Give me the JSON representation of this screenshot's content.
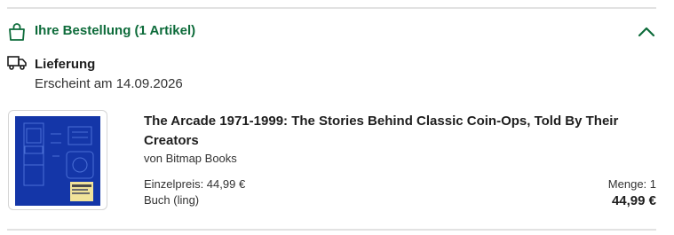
{
  "order": {
    "title": "Ihre Bestellung (1 Artikel)",
    "accent_color": "#0d6b3a",
    "icons": {
      "bag": "shopping-bag-icon",
      "toggle": "chevron-up-icon"
    }
  },
  "delivery": {
    "label": "Lieferung",
    "date_text": "Erscheint am 14.09.2026",
    "icon": "truck-icon"
  },
  "item": {
    "title": "The Arcade 1971-1999: The Stories Behind Classic Coin-Ops, Told By Their Creators",
    "publisher": "von Bitmap Books",
    "unit_price": "Einzelpreis: 44,99 €",
    "format": "Buch (ling)",
    "quantity": "Menge: 1",
    "total": "44,99 €",
    "cover_color": "#1436a8"
  }
}
